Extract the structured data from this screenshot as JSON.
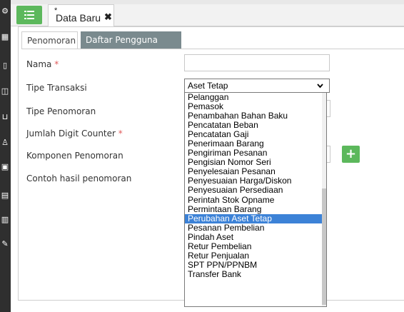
{
  "tabs": {
    "document_tab": {
      "label": "Data Baru",
      "modified_mark": "*",
      "close_glyph": "✖"
    }
  },
  "inner_tabs": [
    {
      "label": "Penomoran"
    },
    {
      "label": "Daftar Pengguna"
    }
  ],
  "form": {
    "required_mark": "*",
    "nama_label": "Nama",
    "tipe_transaksi_label": "Tipe Transaksi",
    "tipe_transaksi_value": "Aset Tetap",
    "tipe_penomoran_label": "Tipe Penomoran",
    "jumlah_digit_label": "Jumlah Digit Counter",
    "komponen_label": "Komponen Penomoran",
    "contoh_label": "Contoh hasil penomoran"
  },
  "dropdown": {
    "options": [
      "Pelanggan",
      "Pemasok",
      "Penambahan Bahan Baku",
      "Pencatatan Beban",
      "Pencatatan Gaji",
      "Penerimaan Barang",
      "Pengiriman Pesanan",
      "Pengisian Nomor Seri",
      "Penyelesaian Pesanan",
      "Penyesuaian Harga/Diskon",
      "Penyesuaian Persediaan",
      "Perintah Stok Opname",
      "Permintaan Barang",
      "Perubahan Aset Tetap",
      "Pesanan Pembelian",
      "Pindah Aset",
      "Retur Pembelian",
      "Retur Penjualan",
      "SPT PPN/PPNBM",
      "Transfer Bank"
    ],
    "highlighted": "Perubahan Aset Tetap"
  },
  "icons": {
    "menu": "list-menu-icon",
    "plus": "plus-icon",
    "chevron": "chevron-down-icon",
    "accent": "#5cb85c",
    "highlight": "#3c82d7"
  }
}
